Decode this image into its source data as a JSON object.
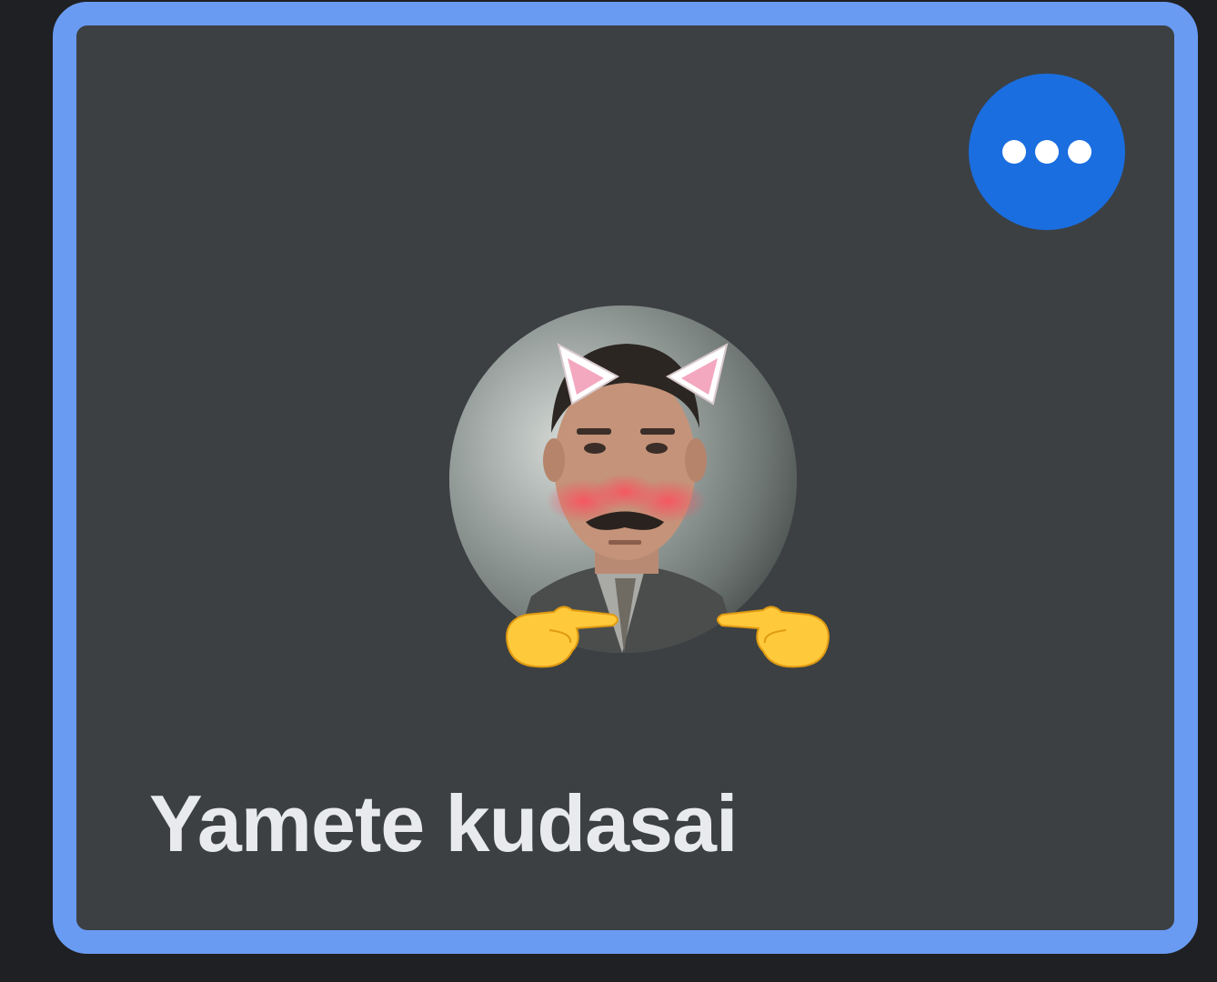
{
  "participant": {
    "name": "Yamete kudasai",
    "more_options_icon": "more-horiz-icon",
    "accent_color": "#6a9bf2",
    "button_color": "#1a6ee0",
    "tile_color": "#3c4043"
  }
}
